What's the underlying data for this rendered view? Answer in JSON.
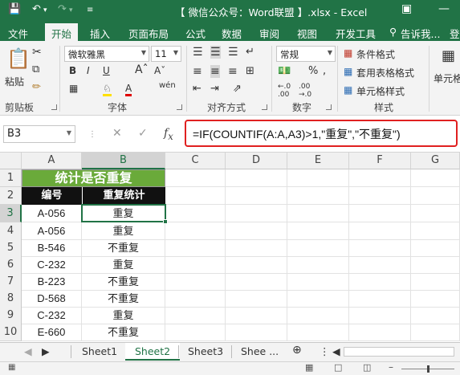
{
  "window": {
    "title": "【 微信公众号：Word联盟 】.xlsx - Excel",
    "sign_in": "登"
  },
  "ribbon_tabs": [
    "文件",
    "开始",
    "插入",
    "页面布局",
    "公式",
    "数据",
    "审阅",
    "视图",
    "开发工具",
    "告诉我..."
  ],
  "ribbon": {
    "paste_label": "粘贴",
    "font_name": "微软雅黑",
    "font_size": "11",
    "number_format": "常规",
    "conditional_format": "条件格式",
    "table_format": "套用表格格式",
    "cell_style": "单元格样式",
    "cells_label": "单元格",
    "groups": [
      "剪贴板",
      "字体",
      "对齐方式",
      "数字",
      "样式"
    ]
  },
  "formula_bar": {
    "name_box": "B3",
    "formula": "=IF(COUNTIF(A:A,A3)>1,\"重复\",\"不重复\")"
  },
  "sheet": {
    "columns": [
      "A",
      "B",
      "C",
      "D",
      "E",
      "F",
      "G"
    ],
    "rows": [
      "1",
      "2",
      "3",
      "4",
      "5",
      "6",
      "7",
      "8",
      "9",
      "10"
    ],
    "title": "统计是否重复",
    "headers": [
      "编号",
      "重复统计"
    ],
    "data": [
      [
        "A-056",
        "重复"
      ],
      [
        "A-056",
        "重复"
      ],
      [
        "B-546",
        "不重复"
      ],
      [
        "C-232",
        "重复"
      ],
      [
        "B-223",
        "不重复"
      ],
      [
        "D-568",
        "不重复"
      ],
      [
        "C-232",
        "重复"
      ],
      [
        "E-660",
        "不重复"
      ]
    ],
    "active_cell": "B3"
  },
  "sheet_tabs": [
    "Sheet1",
    "Sheet2",
    "Sheet3",
    "Shee ..."
  ],
  "active_sheet": "Sheet2",
  "colors": {
    "excel_green": "#217346",
    "title_fill": "#6aaa3a",
    "header_fill": "#111111",
    "highlight_border": "#e02020"
  }
}
